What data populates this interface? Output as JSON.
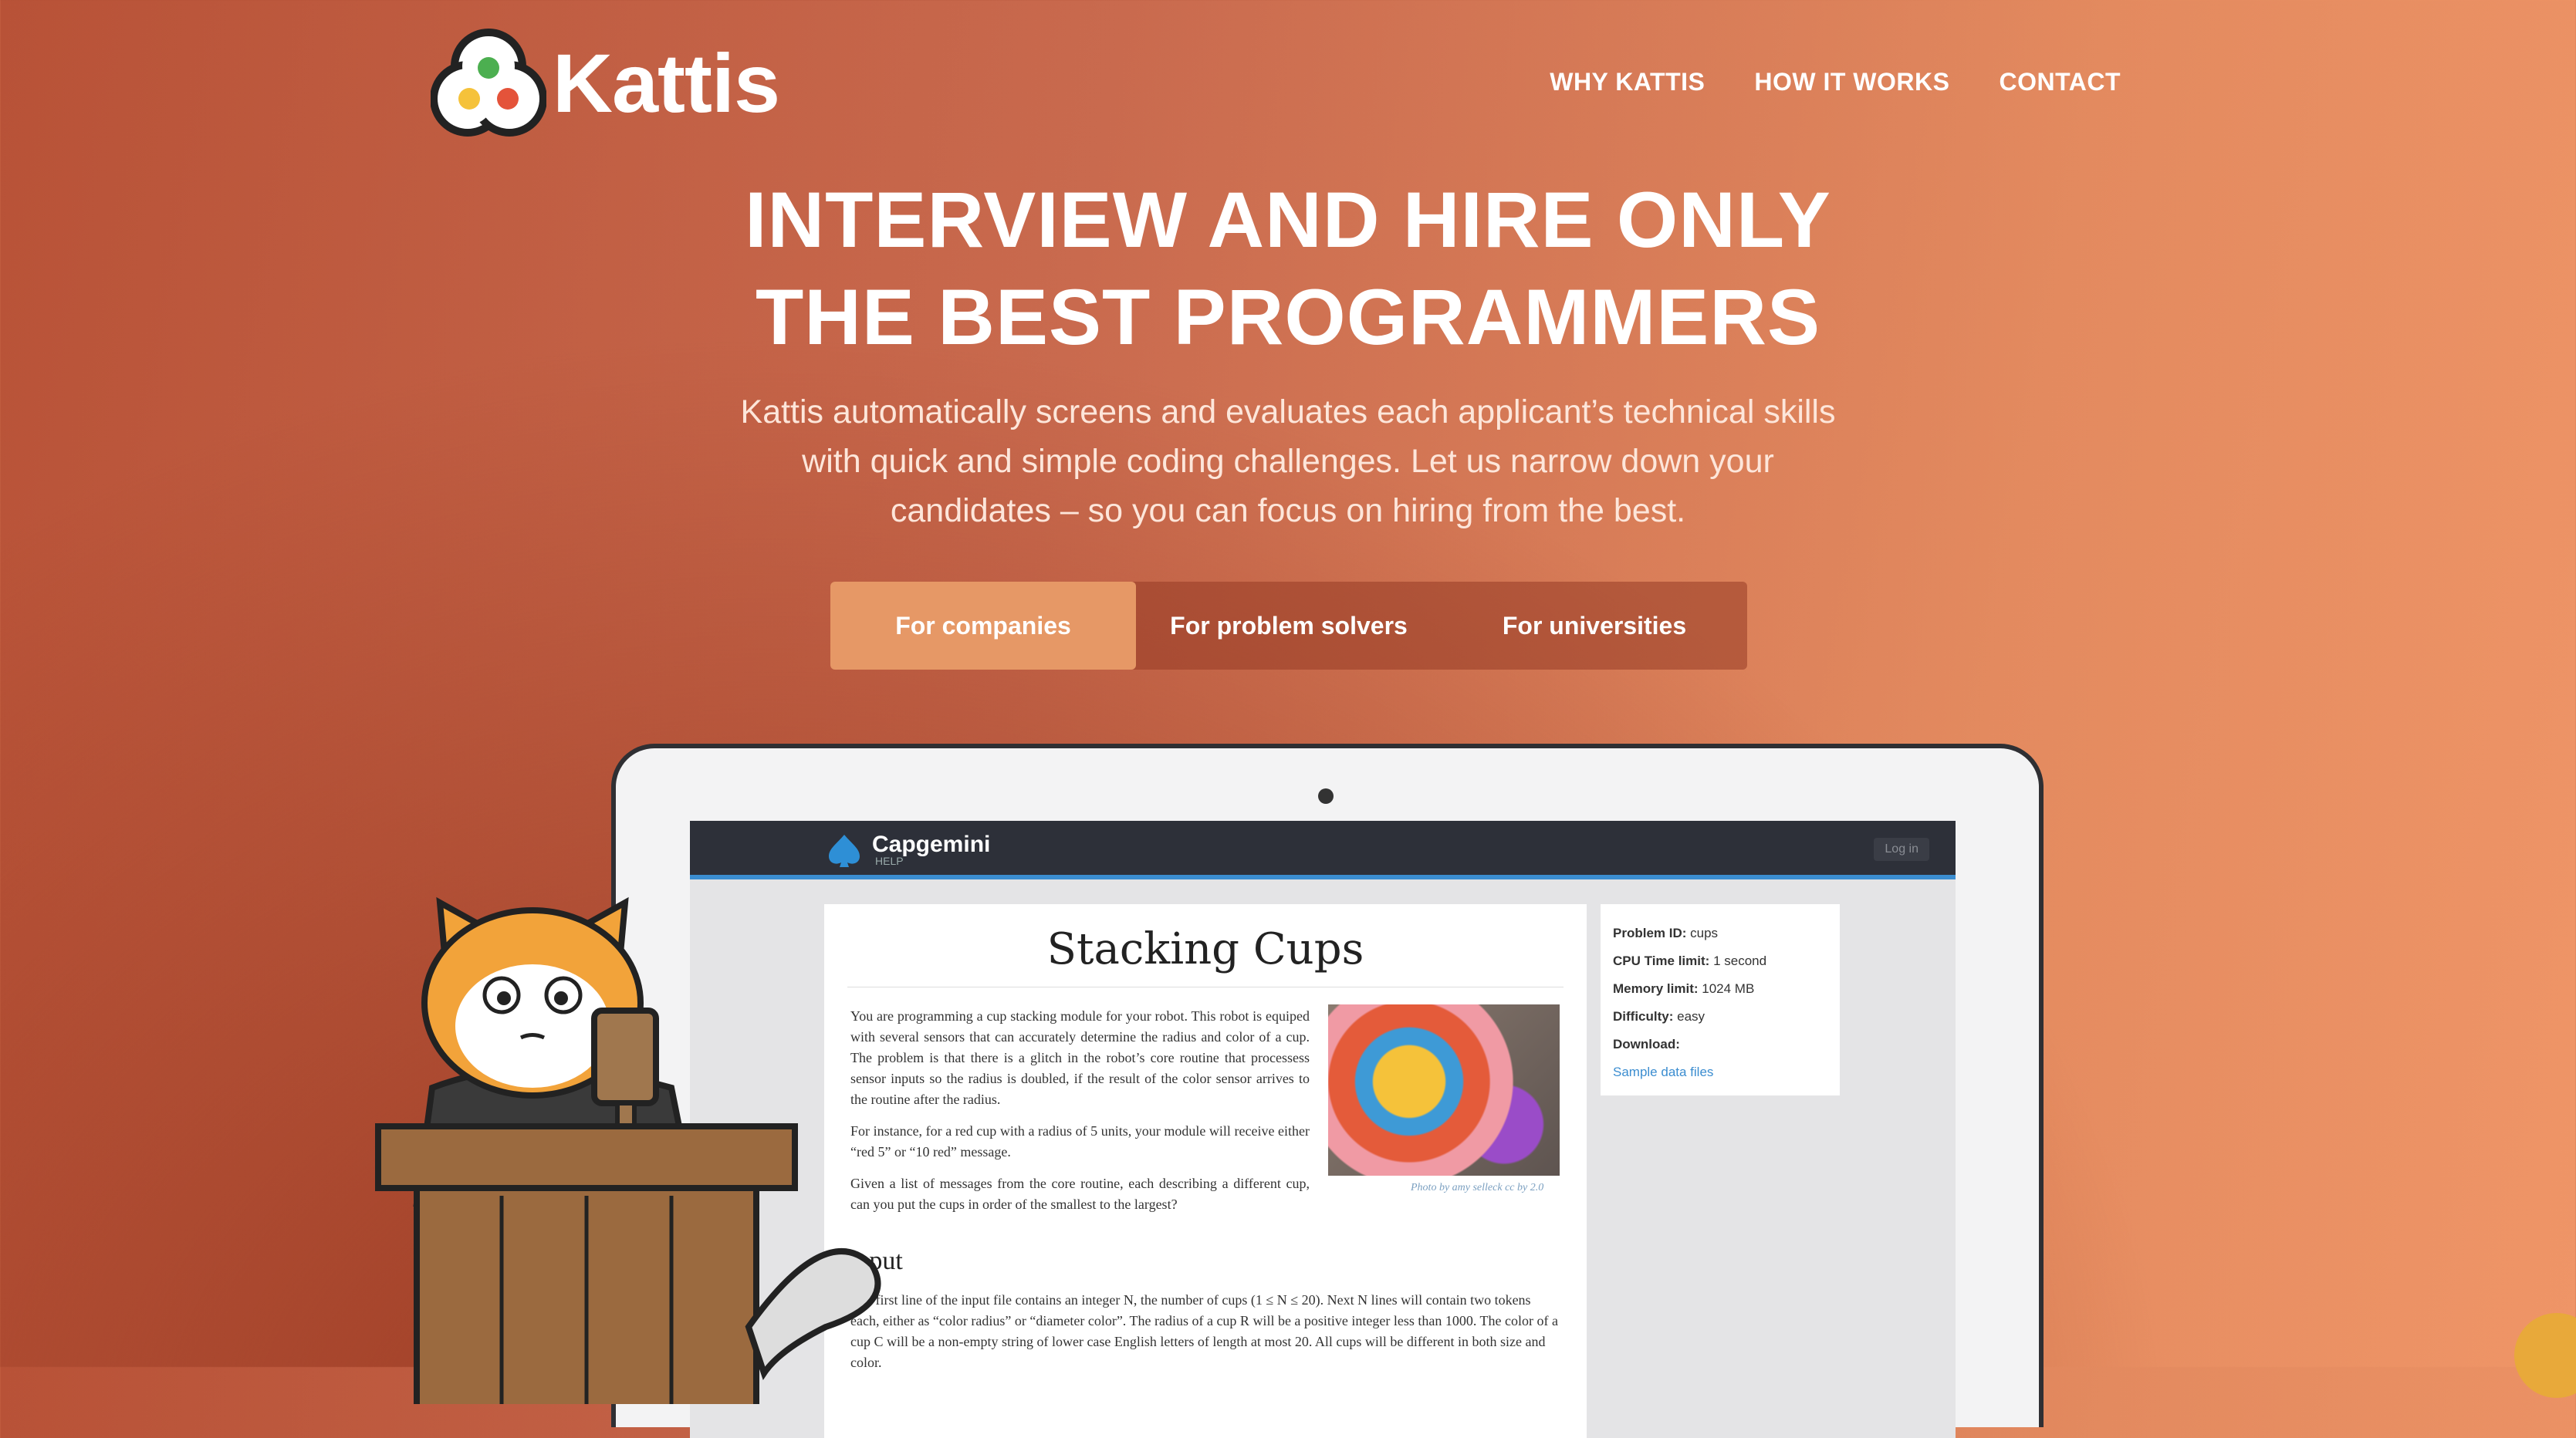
{
  "brand": {
    "name": "Kattis",
    "logo_icon": "kattis-logo-icon"
  },
  "nav": {
    "items": [
      "WHY KATTIS",
      "HOW IT WORKS",
      "CONTACT"
    ]
  },
  "hero": {
    "headline_line1": "INTERVIEW AND HIRE ONLY",
    "headline_line2": "THE BEST PROGRAMMERS",
    "sub_line1": "Kattis automatically screens and evaluates each applicant’s technical skills",
    "sub_line2": "with quick and simple coding challenges. Let us narrow down your",
    "sub_line3": "candidates – so you can focus on hiring from the best."
  },
  "tabs": [
    {
      "label": "For companies",
      "active": true
    },
    {
      "label": "For problem solvers",
      "active": false
    },
    {
      "label": "For universities",
      "active": false
    }
  ],
  "screen": {
    "brand": "Capgemini",
    "brand_sub": "HELP",
    "login": "Log in",
    "problem": {
      "title": "Stacking Cups",
      "para1": "You are programming a cup stacking module for your robot. This robot is equiped with several sensors that can accurately determine the radius and color of a cup. The problem is that there is a glitch in the robot’s core routine that processess sensor inputs so the radius is doubled, if the result of the color sensor arrives to the routine after the radius.",
      "para2": "For instance, for a red cup with a radius of 5 units, your module will receive either “red 5” or “10 red” message.",
      "para3": "Given a list of messages from the core routine, each describing a different cup, can you put the cups in order of the smallest to the largest?",
      "caption": "Photo by amy selleck cc by 2.0",
      "input_heading": "Input",
      "input_text": "The first line of the input file contains an integer N, the number of cups (1 ≤ N ≤ 20). Next N lines will contain two tokens each, either as “color radius” or “diameter color”. The radius of a cup R will be a positive integer less than 1000. The color of a cup C will be a non-empty string of lower case English letters of length at most 20. All cups will be different in both size and color."
    },
    "sidebar": {
      "problem_id_label": "Problem ID:",
      "problem_id": "cups",
      "cpu_label": "CPU Time limit:",
      "cpu": "1 second",
      "memory_label": "Memory limit:",
      "memory": "1024 MB",
      "difficulty_label": "Difficulty:",
      "difficulty": "easy",
      "download_label": "Download:",
      "sample_link": "Sample data files"
    }
  },
  "colors": {
    "accent": "#e69866",
    "tab_bar": "#9a3a24",
    "link": "#3b8dd0"
  }
}
